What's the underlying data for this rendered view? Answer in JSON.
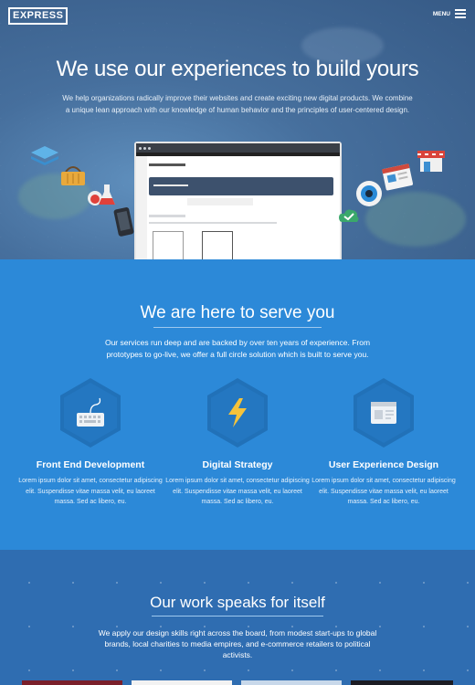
{
  "header": {
    "logo": "EXPRESS",
    "menu_label": "MENU"
  },
  "hero": {
    "title": "We use our experiences to build yours",
    "text": "We help organizations radically improve their websites and create exciting new digital products. We combine a unique lean approach with our knowledge of human behavior and the principles of user-centered design."
  },
  "serve": {
    "title": "We are here to serve you",
    "lead": "Our services run deep and are backed by over ten years of experience. From prototypes to go-live, we offer a full circle solution which is built to serve you.",
    "services": [
      {
        "icon": "keyboard-icon",
        "title": "Front End Development",
        "text": "Lorem ipsum dolor sit amet, consectetur adipiscing elit. Suspendisse vitae massa velit, eu laoreet massa. Sed ac libero, eu."
      },
      {
        "icon": "lightning-icon",
        "title": "Digital Strategy",
        "text": "Lorem ipsum dolor sit amet, consectetur adipiscing elit. Suspendisse vitae massa velit, eu laoreet massa. Sed ac libero, eu."
      },
      {
        "icon": "browser-window-icon",
        "title": "User Experience Design",
        "text": "Lorem ipsum dolor sit amet, consectetur adipiscing elit. Suspendisse vitae massa velit, eu laoreet massa. Sed ac libero, eu."
      }
    ]
  },
  "work": {
    "title": "Our work speaks for itself",
    "text": "We apply our design skills right across the board, from modest start-ups to global brands, local charities to media empires, and e-commerce retailers to political activists."
  },
  "colors": {
    "hero_bg": "#466f9d",
    "services_bg": "#2c89d8",
    "hex": "#2171b8",
    "work_bg": "#2f6db1",
    "accent_yellow": "#f5c33b"
  }
}
